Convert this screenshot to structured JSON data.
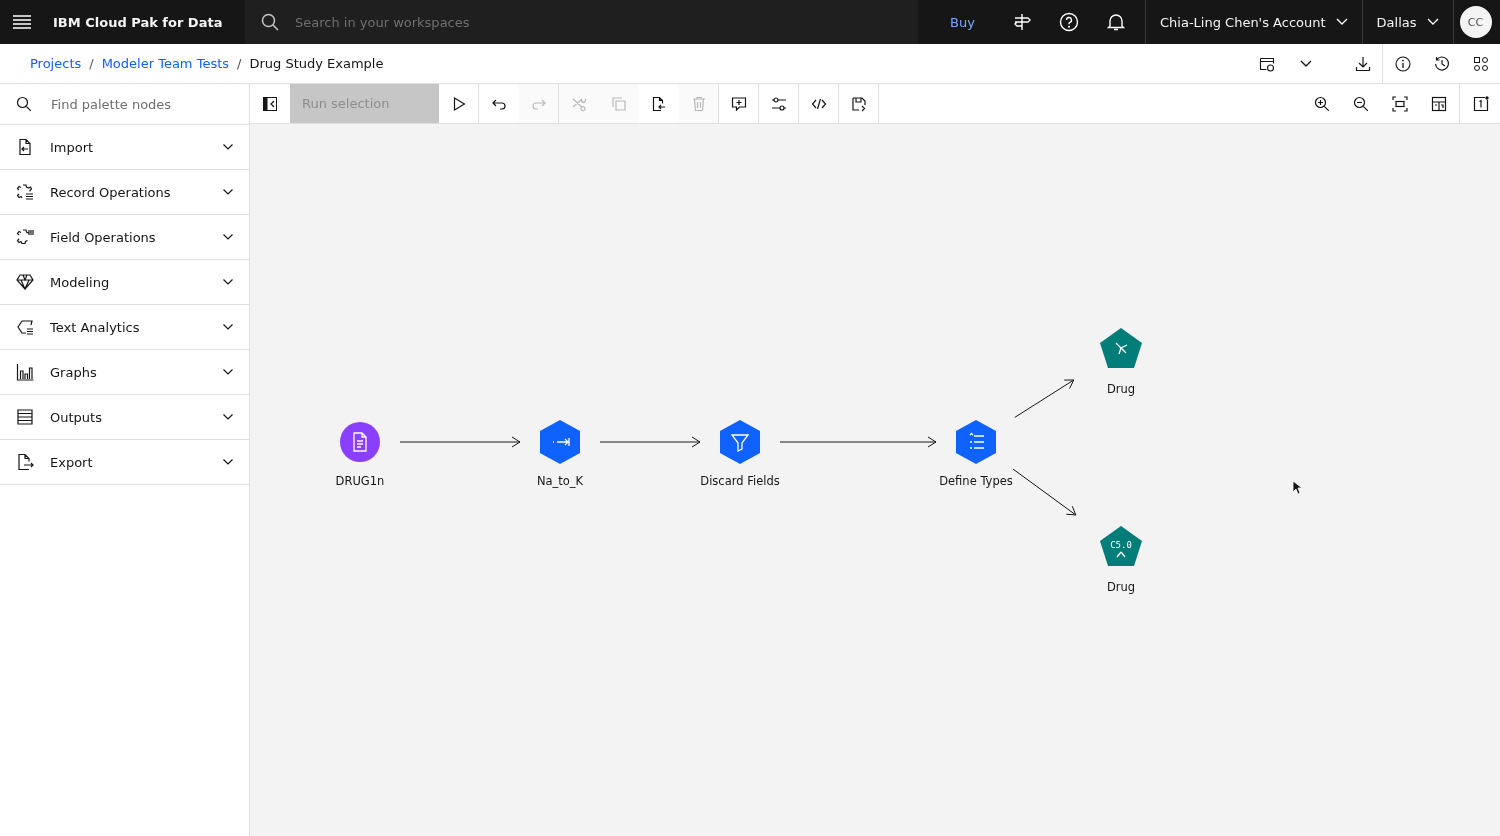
{
  "header": {
    "product": "IBM Cloud Pak for Data",
    "search": {
      "placeholder": "Search in your workspaces"
    },
    "buy": "Buy",
    "account": "Chia-Ling Chen's Account",
    "region": "Dallas",
    "avatar": "CC"
  },
  "breadcrumb": [
    {
      "label": "Projects",
      "link": true
    },
    {
      "separator": "/",
      "label": "Modeler Team Tests",
      "link": true
    },
    {
      "separator": "/",
      "label": "Drug Study Example",
      "link": false
    }
  ],
  "palette": {
    "search": {
      "placeholder": "Find palette nodes"
    },
    "categories": [
      {
        "label": "Import",
        "expanded": false
      },
      {
        "label": "Record Operations",
        "expanded": false
      },
      {
        "label": "Field Operations",
        "expanded": false
      },
      {
        "label": "Modeling",
        "expanded": false
      },
      {
        "label": "Text Analytics",
        "expanded": false
      },
      {
        "label": "Graphs",
        "expanded": false
      },
      {
        "label": "Outputs",
        "expanded": false
      },
      {
        "label": "Export",
        "expanded": false
      }
    ]
  },
  "toolbar": {
    "run_selection": {
      "label": "Run selection",
      "disabled": true
    },
    "tools": [
      {
        "disabled": false
      },
      {
        "disabled": false
      },
      {
        "disabled": true
      },
      {
        "disabled": true
      },
      {
        "disabled": true
      },
      {
        "disabled": false
      },
      {
        "disabled": true
      },
      {
        "disabled": false
      },
      {
        "disabled": false
      },
      {
        "disabled": false
      },
      {
        "disabled": false
      }
    ]
  },
  "canvas": {
    "nodes": [
      {
        "label": "DRUG1n",
        "kind": "source"
      },
      {
        "label": "Na_to_K",
        "kind": "process"
      },
      {
        "label": "Discard Fields",
        "kind": "process"
      },
      {
        "label": "Define Types",
        "kind": "process"
      },
      {
        "label": "Drug",
        "kind": "model"
      },
      {
        "label": "Drug",
        "kind": "model",
        "badge": "C5.0"
      }
    ]
  }
}
